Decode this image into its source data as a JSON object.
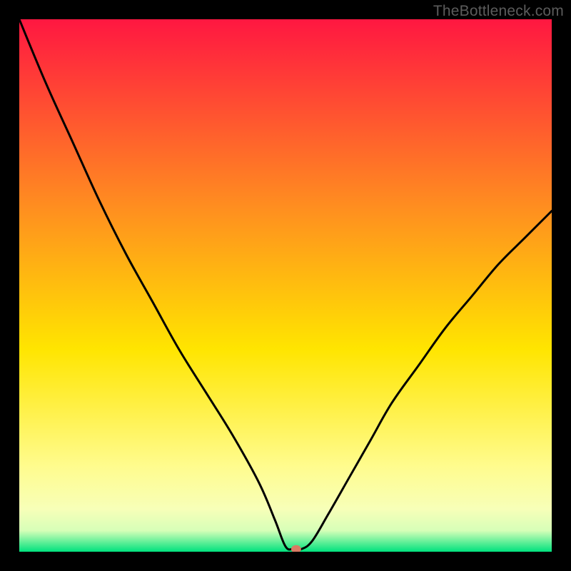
{
  "watermark": "TheBottleneck.com",
  "chart_data": {
    "type": "line",
    "title": "",
    "xlabel": "",
    "ylabel": "",
    "xlim": [
      0,
      1
    ],
    "ylim": [
      0,
      100
    ],
    "x": [
      0.0,
      0.05,
      0.1,
      0.15,
      0.2,
      0.25,
      0.3,
      0.35,
      0.4,
      0.45,
      0.48,
      0.5,
      0.515,
      0.53,
      0.55,
      0.58,
      0.62,
      0.66,
      0.7,
      0.75,
      0.8,
      0.85,
      0.9,
      0.95,
      1.0
    ],
    "series": [
      {
        "name": "bottleneck-curve",
        "values": [
          100,
          88,
          77,
          66,
          56,
          47,
          38,
          30,
          22,
          13,
          6,
          1,
          0.5,
          0.5,
          2,
          7,
          14,
          21,
          28,
          35,
          42,
          48,
          54,
          59,
          64
        ]
      }
    ],
    "marker": {
      "x": 0.52,
      "y": 0.5
    },
    "background_gradient": {
      "top": "#ff1741",
      "mid1": "#ff8d20",
      "mid2": "#ffe500",
      "mid3": "#fffc8e",
      "bottom_band_top": "#f7ffb8",
      "bottom_band_green": "#00e27e"
    }
  }
}
